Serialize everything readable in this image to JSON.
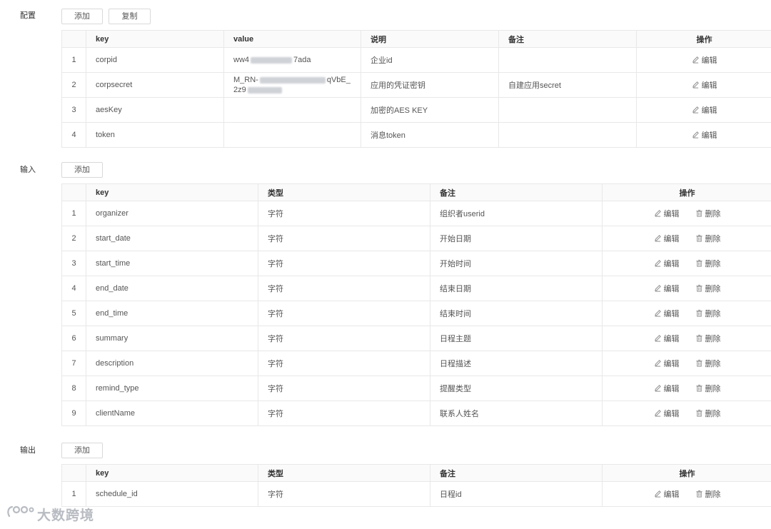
{
  "config": {
    "label": "配置",
    "add_label": "添加",
    "copy_label": "复制",
    "columns": [
      "key",
      "value",
      "说明",
      "备注",
      "操作"
    ],
    "rows": [
      {
        "index": "1",
        "key": "corpid",
        "value_start": "ww4",
        "value_end": "7ada",
        "desc": "企业id",
        "note": ""
      },
      {
        "index": "2",
        "key": "corpsecret",
        "value_start": "M_RN-",
        "value_end": "qVbE_",
        "value_line2": "2z9",
        "desc": "应用的凭证密钥",
        "note": "自建应用secret"
      },
      {
        "index": "3",
        "key": "aesKey",
        "value_start": "",
        "value_end": "",
        "desc": "加密的AES KEY",
        "note": ""
      },
      {
        "index": "4",
        "key": "token",
        "value_start": "",
        "value_end": "",
        "desc": "消息token",
        "note": ""
      }
    ]
  },
  "input": {
    "label": "输入",
    "add_label": "添加",
    "columns": [
      "key",
      "类型",
      "备注",
      "操作"
    ],
    "rows": [
      {
        "index": "1",
        "key": "organizer",
        "type": "字符",
        "note": "组织者userid"
      },
      {
        "index": "2",
        "key": "start_date",
        "type": "字符",
        "note": "开始日期"
      },
      {
        "index": "3",
        "key": "start_time",
        "type": "字符",
        "note": "开始时间"
      },
      {
        "index": "4",
        "key": "end_date",
        "type": "字符",
        "note": "结束日期"
      },
      {
        "index": "5",
        "key": "end_time",
        "type": "字符",
        "note": "结束时间"
      },
      {
        "index": "6",
        "key": "summary",
        "type": "字符",
        "note": "日程主题"
      },
      {
        "index": "7",
        "key": "description",
        "type": "字符",
        "note": "日程描述"
      },
      {
        "index": "8",
        "key": "remind_type",
        "type": "字符",
        "note": "提醒类型"
      },
      {
        "index": "9",
        "key": "clientName",
        "type": "字符",
        "note": "联系人姓名"
      }
    ]
  },
  "output": {
    "label": "输出",
    "add_label": "添加",
    "columns": [
      "key",
      "类型",
      "备注",
      "操作"
    ],
    "rows": [
      {
        "index": "1",
        "key": "schedule_id",
        "type": "字符",
        "note": "日程id"
      }
    ]
  },
  "actions": {
    "edit_label": "编辑",
    "delete_label": "删除",
    "edit_icon": "pencil-icon",
    "delete_icon": "trash-icon"
  },
  "watermark": {
    "text": "大数跨境",
    "icon": "brand-logo-icon"
  },
  "colors": {
    "border": "#e8e8e8",
    "header_bg": "#fafafa",
    "text": "#555555",
    "watermark": "#b8bcc2"
  }
}
